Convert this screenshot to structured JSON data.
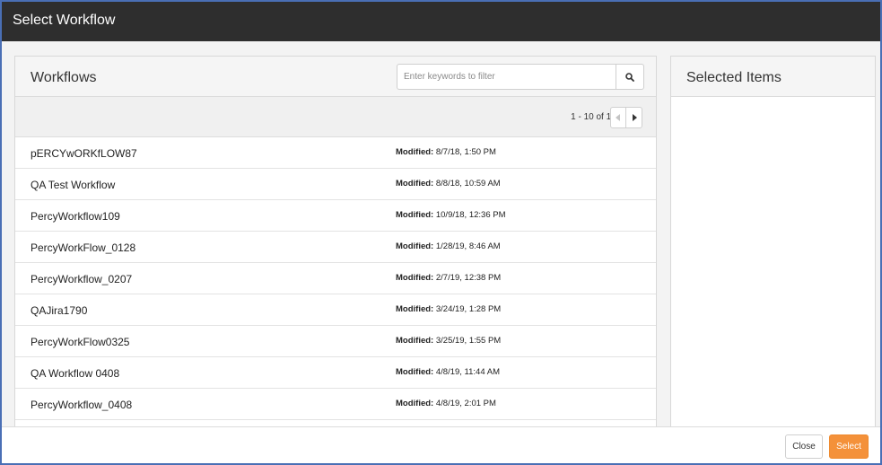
{
  "dialog": {
    "title": "Select Workflow"
  },
  "workflows": {
    "title": "Workflows",
    "search": {
      "placeholder": "Enter keywords to filter",
      "value": ""
    },
    "pagination": {
      "label": "1 - 10 of 11"
    },
    "modified_label": "Modified:",
    "rows": [
      {
        "name": "pERCYwORKfLOW87",
        "modified": "8/7/18, 1:50 PM"
      },
      {
        "name": "QA Test Workflow",
        "modified": "8/8/18, 10:59 AM"
      },
      {
        "name": "PercyWorkflow109",
        "modified": "10/9/18, 12:36 PM"
      },
      {
        "name": "PercyWorkFlow_0128",
        "modified": "1/28/19, 8:46 AM"
      },
      {
        "name": "PercyWorkflow_0207",
        "modified": "2/7/19, 12:38 PM"
      },
      {
        "name": "QAJira1790",
        "modified": "3/24/19, 1:28 PM"
      },
      {
        "name": "PercyWorkFlow0325",
        "modified": "3/25/19, 1:55 PM"
      },
      {
        "name": "QA Workflow 0408",
        "modified": "4/8/19, 11:44 AM"
      },
      {
        "name": "PercyWorkflow_0408",
        "modified": "4/8/19, 2:01 PM"
      },
      {
        "name": "",
        "modified": ""
      }
    ]
  },
  "selected": {
    "title": "Selected Items"
  },
  "footer": {
    "close_label": "Close",
    "select_label": "Select"
  },
  "icons": {
    "search": "search-icon",
    "prev": "chevron-left-icon",
    "next": "chevron-right-icon"
  },
  "colors": {
    "titlebar": "#2e2e2e",
    "accent": "#f4913a",
    "border": "#4a6fb5"
  }
}
